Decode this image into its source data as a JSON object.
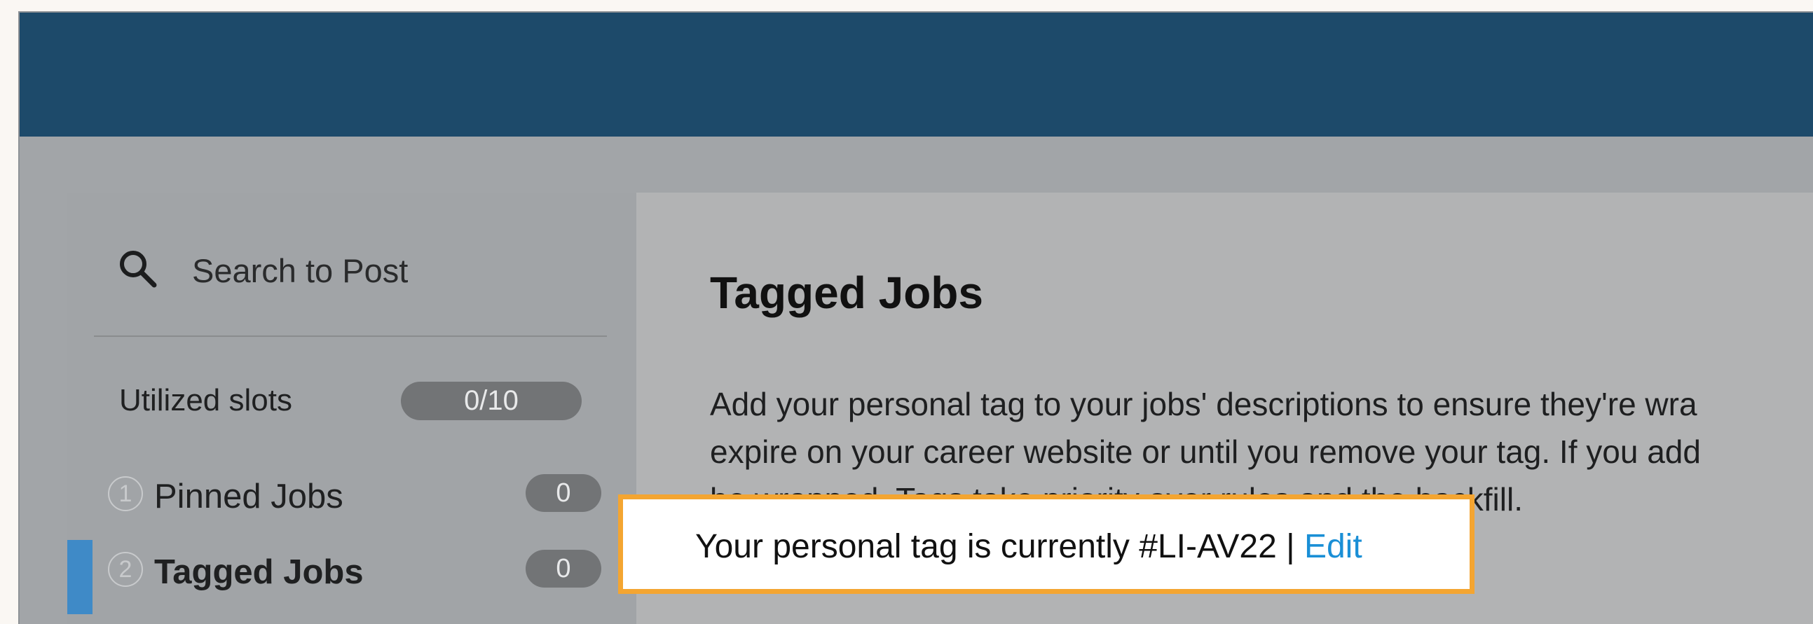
{
  "colors": {
    "topbar": "#1d4a6a",
    "active_indicator": "#3f8ac7",
    "highlight_border": "#f4a531",
    "link": "#1a8fd6"
  },
  "sidebar": {
    "search": {
      "icon": "search-icon",
      "label": "Search to Post"
    },
    "utilized_slots": {
      "label": "Utilized slots",
      "value": "0/10"
    },
    "items": [
      {
        "number": "1",
        "label": "Pinned Jobs",
        "count": "0",
        "active": false
      },
      {
        "number": "2",
        "label": "Tagged Jobs",
        "count": "0",
        "active": true
      }
    ]
  },
  "main": {
    "title": "Tagged Jobs",
    "description_lines": [
      "Add your personal tag to your jobs' descriptions to ensure they're wra",
      "expire on your career website or until you remove your tag. If you add",
      "be wrapped. Tags take priority over rules and the backfill."
    ],
    "personal_tag": {
      "text": "Your personal tag is currently #LI-AV22 | ",
      "edit_label": "Edit"
    }
  }
}
